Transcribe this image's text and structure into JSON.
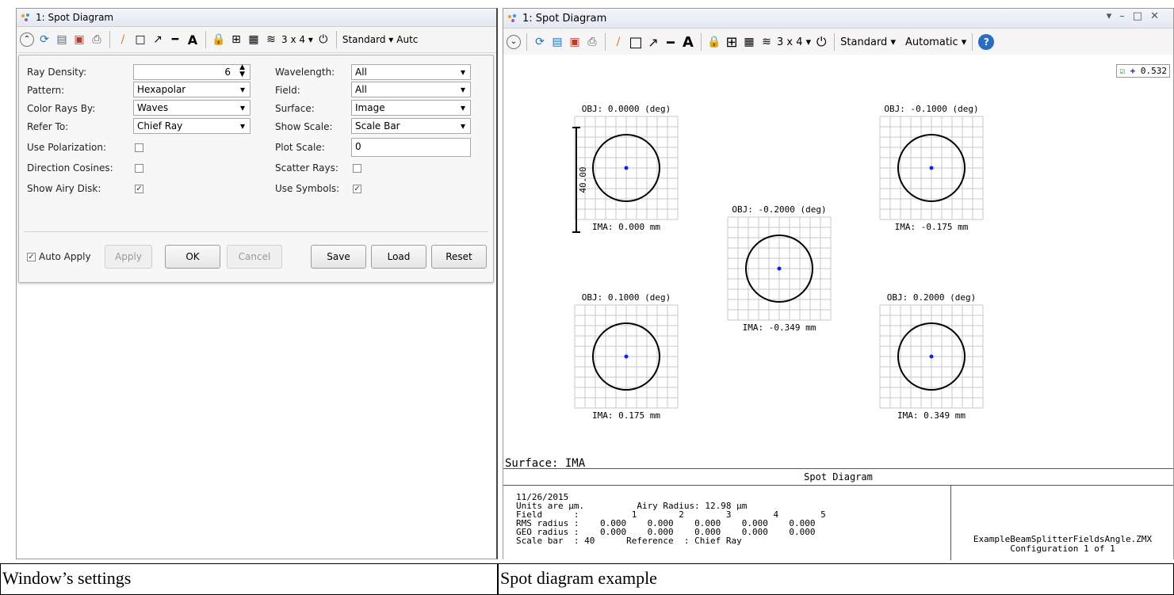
{
  "left_window": {
    "title": "1: Spot Diagram",
    "toolbar": {
      "grid_label": "3 x 4",
      "standard_label": "Standard",
      "auto_label": "Autc"
    },
    "settings": {
      "ray_density_label": "Ray Density:",
      "ray_density_value": "6",
      "pattern_label": "Pattern:",
      "pattern_value": "Hexapolar",
      "color_rays_label": "Color Rays By:",
      "color_rays_value": "Waves",
      "refer_to_label": "Refer To:",
      "refer_to_value": "Chief Ray",
      "use_polarization_label": "Use Polarization:",
      "use_polarization_checked": false,
      "direction_cosines_label": "Direction Cosines:",
      "direction_cosines_checked": false,
      "show_airy_label": "Show Airy Disk:",
      "show_airy_checked": true,
      "wavelength_label": "Wavelength:",
      "wavelength_value": "All",
      "field_label": "Field:",
      "field_value": "All",
      "surface_label": "Surface:",
      "surface_value": "Image",
      "show_scale_label": "Show Scale:",
      "show_scale_value": "Scale Bar",
      "plot_scale_label": "Plot Scale:",
      "plot_scale_value": "0",
      "scatter_rays_label": "Scatter Rays:",
      "scatter_rays_checked": false,
      "use_symbols_label": "Use Symbols:",
      "use_symbols_checked": true,
      "auto_apply_label": "Auto Apply",
      "auto_apply_checked": true,
      "apply_label": "Apply",
      "ok_label": "OK",
      "cancel_label": "Cancel",
      "save_label": "Save",
      "load_label": "Load",
      "reset_label": "Reset"
    }
  },
  "right_window": {
    "title": "1: Spot Diagram",
    "toolbar": {
      "grid_label": "3 x 4",
      "standard_label": "Standard",
      "auto_label": "Automatic"
    },
    "wavelength_legend": "0.532",
    "spots": [
      {
        "obj": "OBJ: 0.0000 (deg)",
        "ima": "IMA: 0.000 mm"
      },
      {
        "obj": "OBJ: -0.1000 (deg)",
        "ima": "IMA: -0.175 mm"
      },
      {
        "obj": "OBJ: -0.2000 (deg)",
        "ima": "IMA: -0.349 mm"
      },
      {
        "obj": "OBJ: 0.1000 (deg)",
        "ima": "IMA: 0.175 mm"
      },
      {
        "obj": "OBJ: 0.2000 (deg)",
        "ima": "IMA: 0.349 mm"
      }
    ],
    "scale_bar_label": "40.00",
    "surface_label": "Surface: IMA",
    "info": {
      "heading": "Spot Diagram",
      "lines": [
        "11/26/2015",
        "Units are µm.          Airy Radius: 12.98 µm",
        "Field      :          1        2        3        4        5",
        "RMS radius :    0.000    0.000    0.000    0.000    0.000",
        "GEO radius :    0.000    0.000    0.000    0.000    0.000",
        "Scale bar  : 40      Reference  : Chief Ray"
      ],
      "file_name": "ExampleBeamSplitterFieldsAngle.ZMX",
      "configuration": "Configuration 1 of 1"
    }
  },
  "captions": {
    "left": "Window’s settings",
    "right": "Spot diagram example"
  },
  "colors": {
    "ray_spot": "#1a1aff",
    "grid": "#c8c8c8"
  }
}
